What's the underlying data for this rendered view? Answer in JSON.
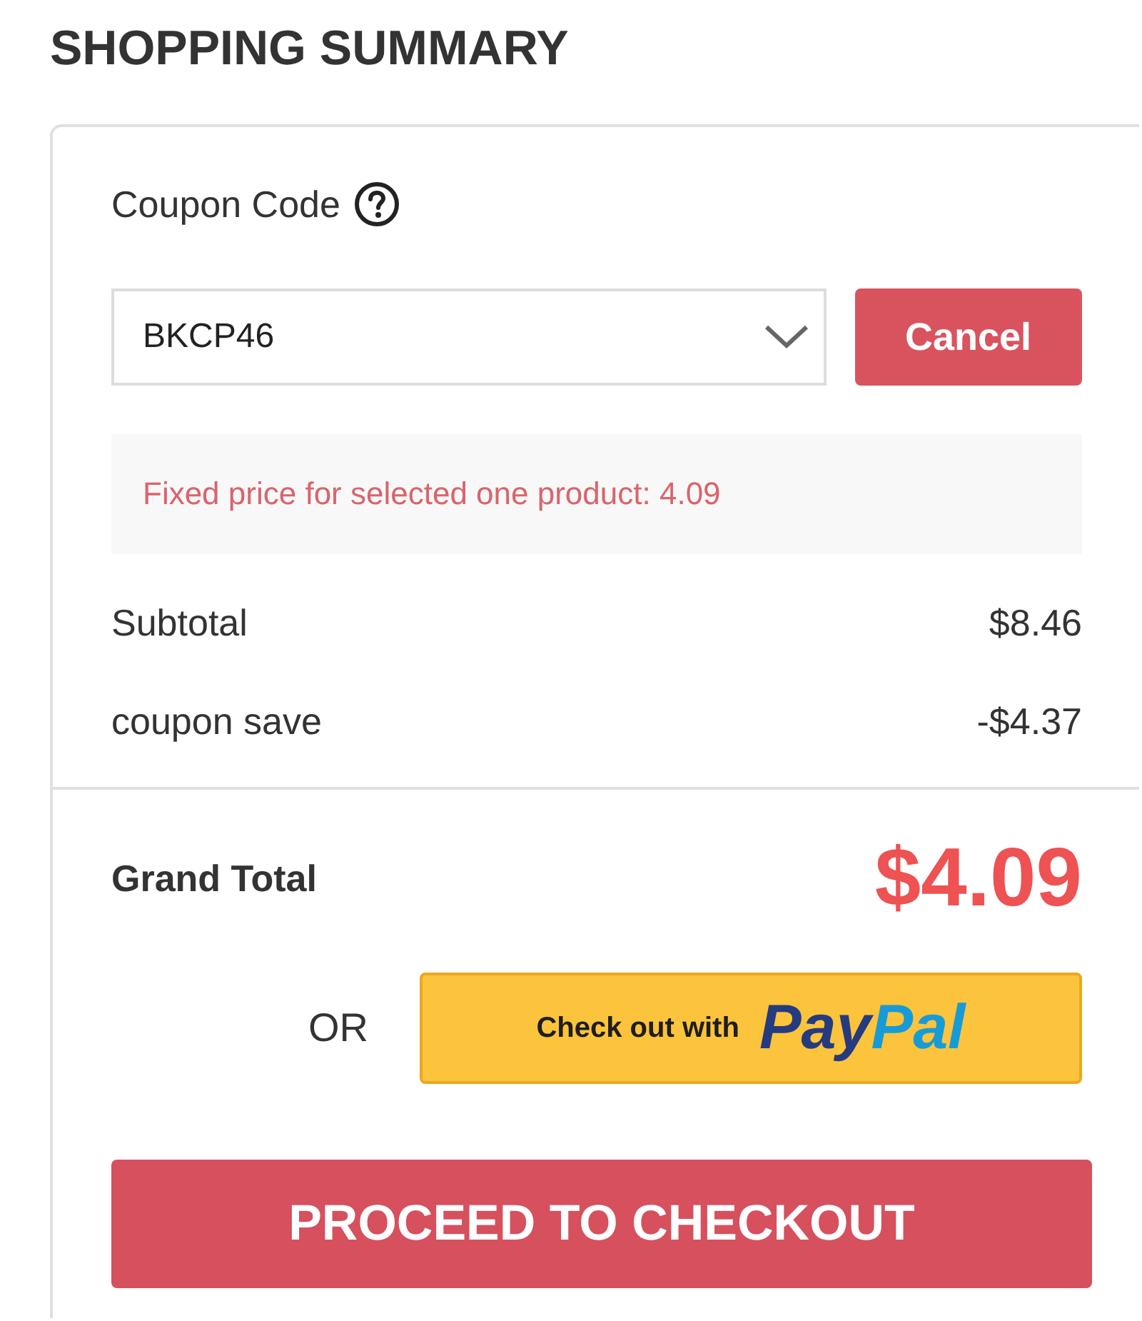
{
  "title": "SHOPPING SUMMARY",
  "coupon": {
    "label": "Coupon Code",
    "value": "BKCP46",
    "cancel_button": "Cancel",
    "message": "Fixed price for selected one product: 4.09"
  },
  "summary_rows": [
    {
      "label": "Subtotal",
      "value": "$8.46"
    },
    {
      "label": "coupon save",
      "value": "-$4.37"
    }
  ],
  "grand_total": {
    "label": "Grand Total",
    "value": "$4.09"
  },
  "alternative": {
    "separator": "OR",
    "paypal_button": {
      "text": "Check out with",
      "logo_parts": [
        "Pay",
        "Pal"
      ]
    }
  },
  "checkout_button": "PROCEED TO CHECKOUT"
}
